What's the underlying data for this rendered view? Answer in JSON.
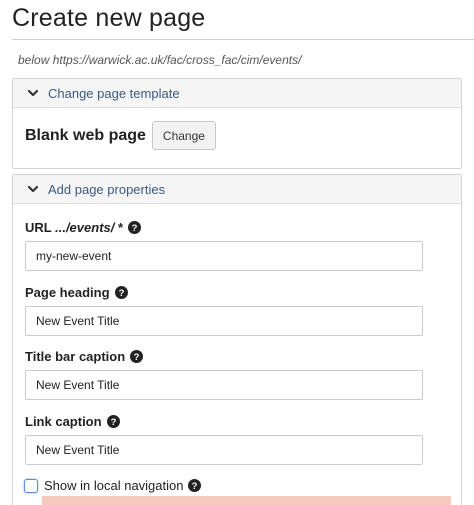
{
  "page": {
    "title": "Create new page",
    "below": "below https://warwick.ac.uk/fac/cross_fac/cim/events/"
  },
  "template_panel": {
    "header_label": "Change page template",
    "template_name": "Blank web page",
    "change_button": "Change"
  },
  "properties_panel": {
    "header_label": "Add page properties",
    "url": {
      "label_prefix": "URL ",
      "label_italic": ".../events/",
      "label_suffix": " *",
      "value": "my-new-event"
    },
    "page_heading": {
      "label": "Page heading",
      "value": "New Event Title"
    },
    "title_bar_caption": {
      "label": "Title bar caption",
      "value": "New Event Title"
    },
    "link_caption": {
      "label": "Link caption",
      "value": "New Event Title"
    },
    "show_in_nav": {
      "label": "Show in local navigation",
      "checked": false
    }
  },
  "icons": {
    "chevron": "chevron-down-icon",
    "help": "question-circle-icon"
  },
  "colors": {
    "header_link": "#3b5a80",
    "alert": "#f6c9bd",
    "focus": "#5b8fd0"
  }
}
